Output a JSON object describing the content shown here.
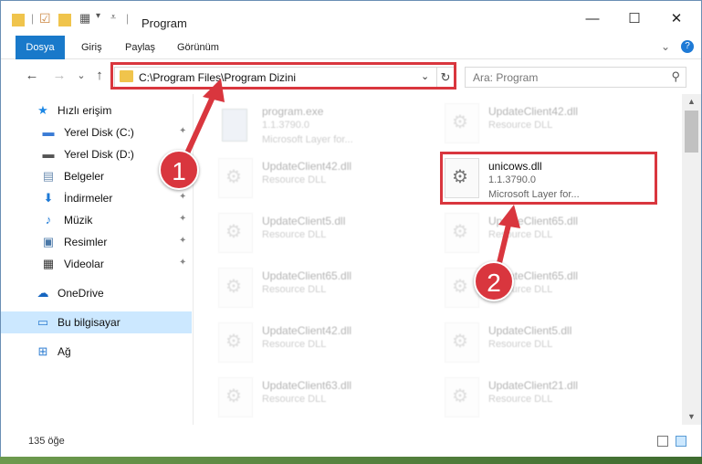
{
  "window": {
    "title": "Program",
    "minimize_glyph": "—",
    "maximize_glyph": "☐",
    "close_glyph": "✕"
  },
  "ribbon": {
    "tabs": [
      "Dosya",
      "Giriş",
      "Paylaş",
      "Görünüm"
    ],
    "expand_glyph": "⌄",
    "help_glyph": "?"
  },
  "nav": {
    "back_glyph": "←",
    "forward_glyph": "→",
    "recent_glyph": "⌄",
    "up_glyph": "↑",
    "address_path": "C:\\Program Files\\Program Dizini",
    "address_chevron": "⌄",
    "refresh_glyph": "↻",
    "search_placeholder": "Ara: Program",
    "search_glyph": "⚲"
  },
  "sidebar": {
    "items": [
      {
        "label": "Hızlı erişim",
        "icon": "star-icon",
        "glyph": "★",
        "color": "#1e88e5",
        "pinned": false
      },
      {
        "label": "Yerel Disk (C:)",
        "icon": "drive-icon",
        "glyph": "▬",
        "color": "#3a7bd5",
        "pinned": true
      },
      {
        "label": "Yerel Disk (D:)",
        "icon": "drive-icon",
        "glyph": "▬",
        "color": "#555555",
        "pinned": false
      },
      {
        "label": "Belgeler",
        "icon": "documents-icon",
        "glyph": "▤",
        "color": "#6f8fb3",
        "pinned": true
      },
      {
        "label": "İndirmeler",
        "icon": "download-icon",
        "glyph": "⬇",
        "color": "#1e7ad6",
        "pinned": true
      },
      {
        "label": "Müzik",
        "icon": "music-icon",
        "glyph": "♪",
        "color": "#1e7ad6",
        "pinned": true
      },
      {
        "label": "Resimler",
        "icon": "pictures-icon",
        "glyph": "▣",
        "color": "#4a78a8",
        "pinned": true
      },
      {
        "label": "Videolar",
        "icon": "videos-icon",
        "glyph": "▦",
        "color": "#333333",
        "pinned": true
      },
      {
        "label": "OneDrive",
        "icon": "onedrive-icon",
        "glyph": "☁",
        "color": "#1565c0",
        "pinned": false
      },
      {
        "label": "Bu bilgisayar",
        "icon": "computer-icon",
        "glyph": "▭",
        "color": "#2d7dd2",
        "pinned": false
      },
      {
        "label": "Ağ",
        "icon": "network-icon",
        "glyph": "⊞",
        "color": "#2d7dd2",
        "pinned": false
      }
    ],
    "pin_glyph": "📌"
  },
  "files": [
    {
      "name": "program.exe",
      "line2": "1.1.3790.0",
      "line3": "Microsoft Layer for...",
      "icon": "exe-icon",
      "faded": true
    },
    {
      "name": "UpdateClient42.dll",
      "line2": "Resource DLL",
      "line3": "",
      "icon": "dll-icon",
      "faded": true
    },
    {
      "name": "UpdateClient42.dll",
      "line2": "Resource DLL",
      "line3": "",
      "icon": "dll-icon",
      "faded": true
    },
    {
      "name": "unicows.dll",
      "line2": "1.1.3790.0",
      "line3": "Microsoft Layer for...",
      "icon": "dll-icon",
      "faded": false
    },
    {
      "name": "UpdateClient5.dll",
      "line2": "Resource DLL",
      "line3": "",
      "icon": "dll-icon",
      "faded": true
    },
    {
      "name": "UpdateClient65.dll",
      "line2": "Resource DLL",
      "line3": "",
      "icon": "dll-icon",
      "faded": true
    },
    {
      "name": "UpdateClient65.dll",
      "line2": "Resource DLL",
      "line3": "",
      "icon": "dll-icon",
      "faded": true
    },
    {
      "name": "UpdateClient65.dll",
      "line2": "Resource DLL",
      "line3": "",
      "icon": "dll-icon",
      "faded": true
    },
    {
      "name": "UpdateClient42.dll",
      "line2": "Resource DLL",
      "line3": "",
      "icon": "dll-icon",
      "faded": true
    },
    {
      "name": "UpdateClient5.dll",
      "line2": "Resource DLL",
      "line3": "",
      "icon": "dll-icon",
      "faded": true
    },
    {
      "name": "UpdateClient63.dll",
      "line2": "Resource DLL",
      "line3": "",
      "icon": "dll-icon",
      "faded": true
    },
    {
      "name": "UpdateClient21.dll",
      "line2": "Resource DLL",
      "line3": "",
      "icon": "dll-icon",
      "faded": true
    }
  ],
  "status": {
    "item_count": "135 öğe"
  },
  "annotations": {
    "badge1": "1",
    "badge2": "2",
    "color": "#d9363e"
  },
  "scroll": {
    "up_glyph": "▲",
    "down_glyph": "▼"
  }
}
